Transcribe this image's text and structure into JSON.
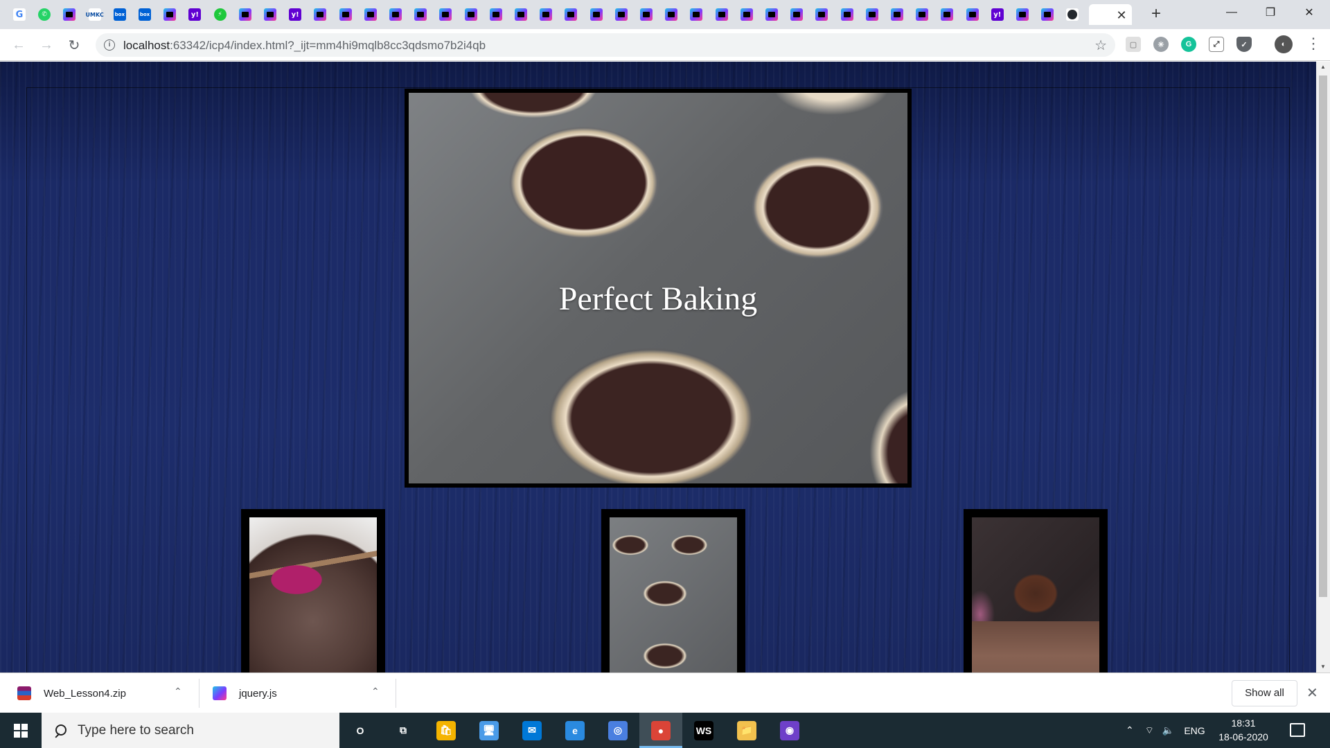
{
  "browser": {
    "tab_favicons": [
      "google-icon",
      "whatsapp-icon",
      "webstorm-icon",
      "umkc-icon",
      "box-icon",
      "box-icon",
      "webstorm-icon",
      "yahoo-icon",
      "green-circle-icon",
      "webstorm-icon",
      "webstorm-icon",
      "yahoo-icon",
      "webstorm-icon",
      "webstorm-icon",
      "webstorm-icon",
      "webstorm-icon",
      "webstorm-icon",
      "webstorm-icon",
      "webstorm-icon",
      "webstorm-icon",
      "webstorm-icon",
      "webstorm-icon",
      "webstorm-icon",
      "webstorm-icon",
      "webstorm-icon",
      "webstorm-icon",
      "webstorm-icon",
      "webstorm-icon",
      "webstorm-icon",
      "webstorm-icon",
      "webstorm-icon",
      "webstorm-icon",
      "webstorm-icon",
      "webstorm-icon",
      "webstorm-icon",
      "webstorm-icon",
      "webstorm-icon",
      "webstorm-icon",
      "webstorm-icon",
      "yahoo-icon",
      "webstorm-icon",
      "webstorm-icon",
      "github-icon",
      "webstorm-icon",
      "webstorm-icon"
    ],
    "address": {
      "host": "localhost",
      "rest": ":63342/icp4/index.html?_ijt=mm4hi9mqlb8cc3qdsmo7b2i4qb"
    },
    "extensions": [
      "pocket-icon",
      "extension-icon",
      "grammarly-icon",
      "screenshot-icon",
      "shield-icon",
      "profile-avatar"
    ]
  },
  "page": {
    "hero_title": "Perfect Baking",
    "thumbnails": [
      {
        "alt": "chocolate batter with spatula"
      },
      {
        "alt": "cupcake tin with batter"
      },
      {
        "alt": "frosted chocolate cupcake"
      }
    ]
  },
  "downloads": {
    "items": [
      {
        "name": "Web_Lesson4.zip",
        "icon": "winrar-icon",
        "color": "#8b1a6b"
      },
      {
        "name": "jquery.js",
        "icon": "webstorm-icon",
        "color": "#1fc4e8"
      }
    ],
    "show_all_label": "Show all"
  },
  "taskbar": {
    "search_placeholder": "Type here to search",
    "pinned": [
      {
        "name": "cortana-icon",
        "glyph": "O"
      },
      {
        "name": "task-view-icon",
        "glyph": "⧉"
      },
      {
        "name": "store-icon",
        "glyph": "🛍"
      },
      {
        "name": "computer-icon",
        "glyph": "🖥"
      },
      {
        "name": "mail-icon",
        "glyph": "✉"
      },
      {
        "name": "edge-icon",
        "glyph": "e"
      },
      {
        "name": "chromium-icon",
        "glyph": "◎"
      },
      {
        "name": "chrome-icon",
        "glyph": "●"
      },
      {
        "name": "webstorm-icon",
        "glyph": "WS"
      },
      {
        "name": "file-explorer-icon",
        "glyph": "📁"
      },
      {
        "name": "github-desktop-icon",
        "glyph": "◉"
      }
    ],
    "language": "ENG",
    "time": "18:31",
    "date": "18-06-2020"
  }
}
